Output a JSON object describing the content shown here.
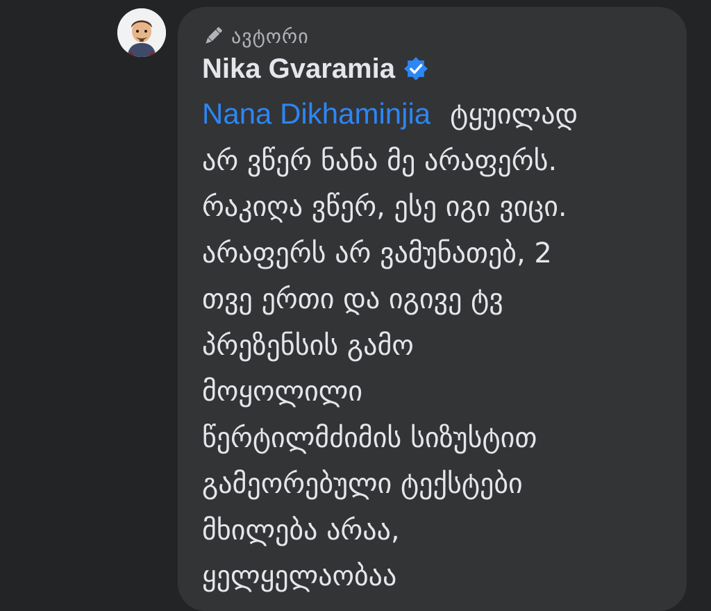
{
  "comment": {
    "badge_label": "ავტორი",
    "author_name": "Nika Gvaramia",
    "mention": "Nana Dikhaminjia",
    "lines": [
      "ტყუილად",
      "არ ვწერ ნანა მე არაფერს.",
      "რაკიღა ვწერ, ესე იგი ვიცი.",
      "არაფერს არ ვამუნათებ, 2",
      "თვე ერთი და იგივე ტვ",
      "პრეზენსის გამო",
      "მოყოლილი",
      "წერტილმძიმის სიზუსტით",
      "გამეორებული ტექსტები",
      "მხილება არაა,",
      "ყელყელაობაა"
    ]
  },
  "icons": {
    "badge": "pen-icon",
    "verified": "verified-badge-icon",
    "avatar": "avatar"
  },
  "colors": {
    "background": "#232426",
    "bubble": "#333436",
    "text": "#e4e6eb",
    "muted": "#b0b3b8",
    "mention": "#2d86f5",
    "verified": "#2d86f5"
  }
}
